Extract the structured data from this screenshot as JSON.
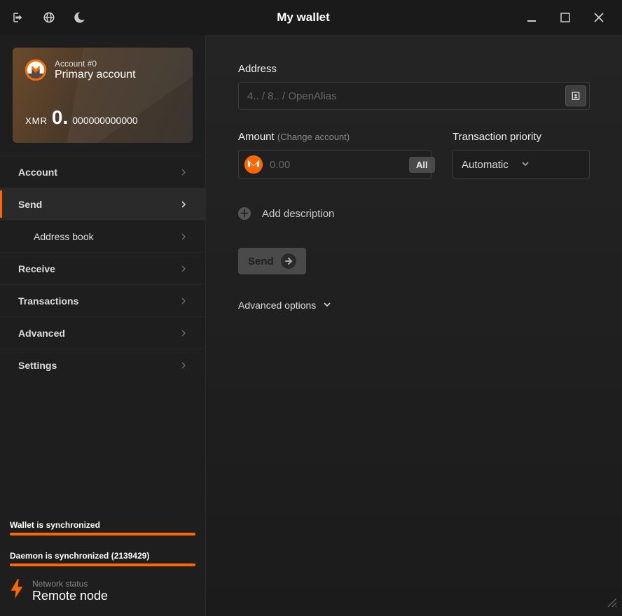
{
  "window": {
    "title": "My wallet"
  },
  "card": {
    "account_num": "Account #0",
    "account_name": "Primary account",
    "currency": "XMR",
    "balance_int": "0.",
    "balance_frac": "000000000000"
  },
  "nav": {
    "account": "Account",
    "send": "Send",
    "address_book": "Address book",
    "receive": "Receive",
    "transactions": "Transactions",
    "advanced": "Advanced",
    "settings": "Settings"
  },
  "status": {
    "wallet": "Wallet is synchronized",
    "daemon": "Daemon is synchronized (2139429)",
    "network_label": "Network status",
    "network_value": "Remote node"
  },
  "form": {
    "address_label": "Address",
    "address_placeholder": "4.. / 8.. / OpenAlias",
    "amount_label": "Amount",
    "change_account": "(Change account)",
    "amount_placeholder": "0.00",
    "all_btn": "All",
    "priority_label": "Transaction priority",
    "priority_value": "Automatic",
    "add_description": "Add description",
    "send_btn": "Send",
    "advanced_options": "Advanced options"
  }
}
